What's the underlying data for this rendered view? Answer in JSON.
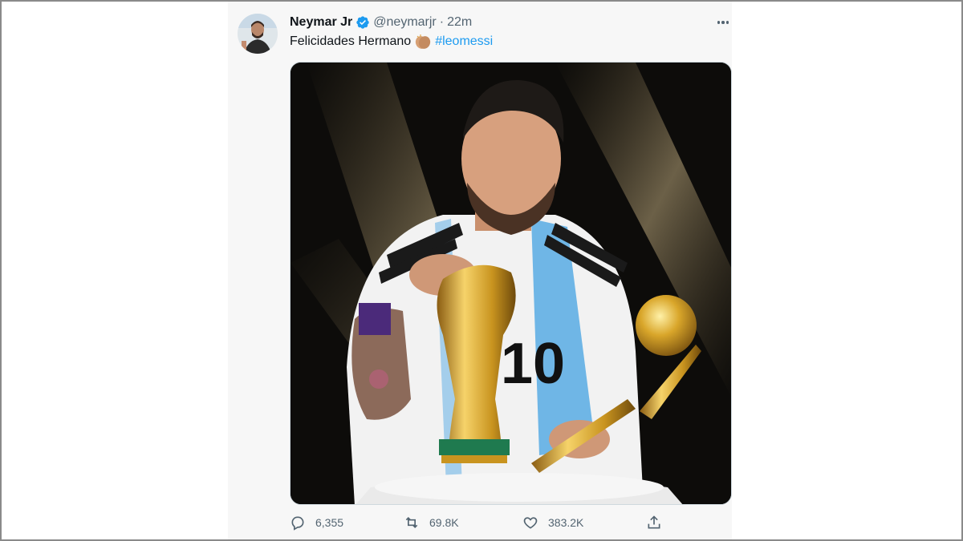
{
  "tweet": {
    "author_name": "Neymar Jr",
    "handle": "@neymarjr",
    "separator": "·",
    "time": "22m",
    "text": "Felicidades Hermano",
    "hashtag": "#leomessi",
    "emoji": "clapping-hands",
    "stats": {
      "replies": "6,355",
      "retweets": "69.8K",
      "likes": "383.2K"
    }
  },
  "icons": {
    "verified": "verified-badge-icon",
    "more": "more-options-icon",
    "reply": "reply-icon",
    "retweet": "retweet-icon",
    "like": "like-icon",
    "share": "share-icon"
  },
  "colors": {
    "link": "#1d9bf0",
    "text": "#0f1419",
    "muted": "#536471",
    "tweet_background": "#f7f7f7"
  }
}
